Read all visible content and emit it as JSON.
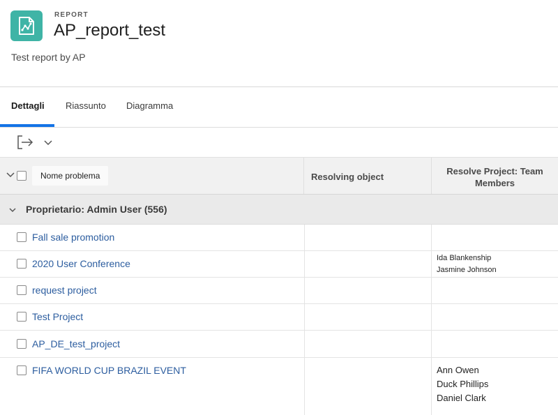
{
  "header": {
    "eyebrow": "REPORT",
    "title": "AP_report_test",
    "description": "Test report by AP",
    "icon": "report-chart-icon",
    "icon_color": "#3fb4a6"
  },
  "tabs": [
    {
      "label": "Dettagli",
      "active": true
    },
    {
      "label": "Riassunto",
      "active": false
    },
    {
      "label": "Diagramma",
      "active": false
    }
  ],
  "accent_color": "#1473e6",
  "toolbar": {
    "export_icon": "export-icon",
    "dropdown_icon": "chevron-down-icon"
  },
  "table": {
    "columns": {
      "name": "Nome problema",
      "resolving_object": "Resolving object",
      "team_members_line1": "Resolve Project: Team",
      "team_members_line2": "Members"
    },
    "group": {
      "label": "Proprietario: Admin User (556)"
    },
    "rows": [
      {
        "name": "Fall sale promotion",
        "members": []
      },
      {
        "name": "2020 User Conference",
        "members": [
          "Ida Blankenship",
          "Jasmine Johnson"
        ]
      },
      {
        "name": "request project",
        "members": []
      },
      {
        "name": "Test Project",
        "members": []
      },
      {
        "name": "AP_DE_test_project",
        "members": []
      },
      {
        "name": "FIFA WORLD CUP BRAZIL EVENT",
        "members": [
          "Ann Owen",
          "Duck Phillips",
          "Daniel Clark"
        ]
      }
    ]
  },
  "link_color": "#2c5d9f"
}
